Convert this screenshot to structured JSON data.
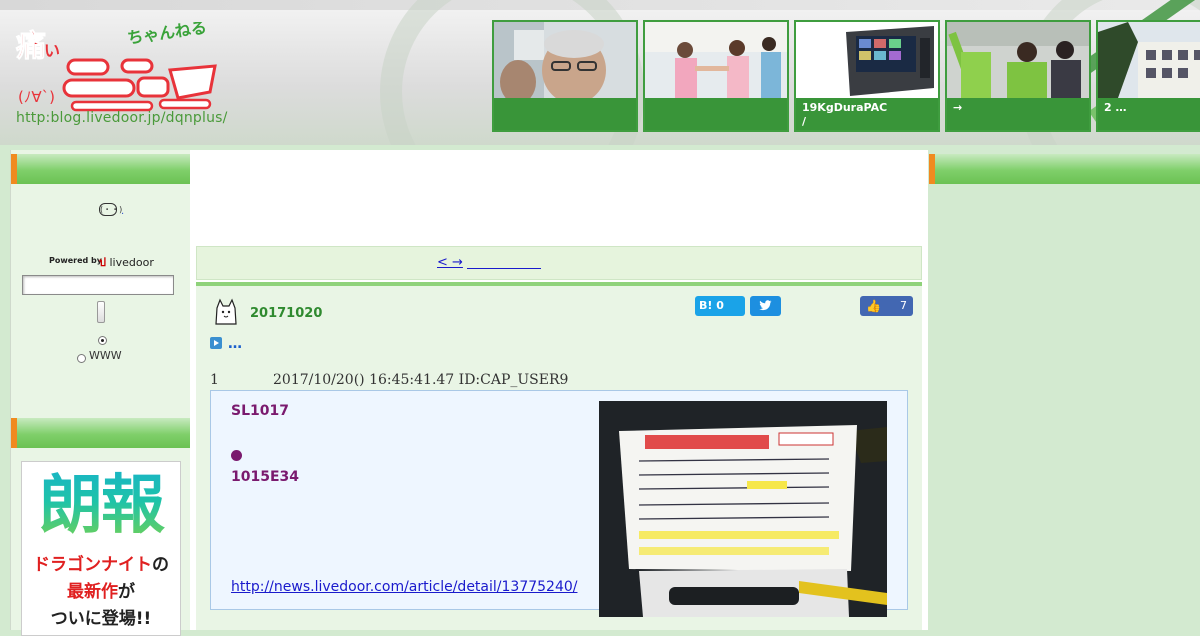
{
  "header": {
    "logo_text_main": "痛いニュース",
    "logo_text_sub": "ちゃんねる",
    "logo_face": "(ﾉ∀`)",
    "logo_url": "http:blog.livedoor.jp/dqnplus/",
    "thumbs": [
      {
        "caption": "",
        "image": "elderly-man-photo"
      },
      {
        "caption": "",
        "image": "children-playing-photo"
      },
      {
        "caption": "19KgDuraPAC\n/",
        "image": "portable-device-photo"
      },
      {
        "caption": "→",
        "image": "campaign-speech-photo"
      },
      {
        "caption": "2 …",
        "image": "school-building-photo"
      }
    ]
  },
  "sidebar": {
    "face_icon": "(・・)",
    "face_suffix": ".",
    "powered_by": "Powered by",
    "livedoor_logo": "livedoor",
    "search_placeholder": "",
    "radio_options": [
      {
        "label": "",
        "selected": true
      },
      {
        "label": "WWW",
        "selected": false
      }
    ],
    "ad": {
      "big_text": "朗報",
      "line1_red": "ドラゴンナイト",
      "line1_rest": "の",
      "line2_red": "最新作",
      "line2_rest": "が",
      "line3": "ついに登場!!"
    }
  },
  "article": {
    "nav_link": "< →",
    "date_title": "20171020",
    "hatena_label": "B!",
    "hatena_count": "0",
    "tweet_icon": "twitter-bird",
    "like_count": "7",
    "more_link": "…",
    "post_number": "1",
    "post_meta": "2017/10/20() 16:45:41.47 ID:CAP_USER9",
    "quote_line1": "SL1017",
    "quote_line3": "1015E34",
    "source_url": "http://news.livedoor.com/article/detail/13775240/"
  },
  "colors": {
    "accent_green": "#3f9d3f",
    "bar_green": "#7fcf6a",
    "orange_tab": "#f08a20",
    "link_blue": "#1a1acc",
    "quote_purple": "#7a1a6e"
  }
}
